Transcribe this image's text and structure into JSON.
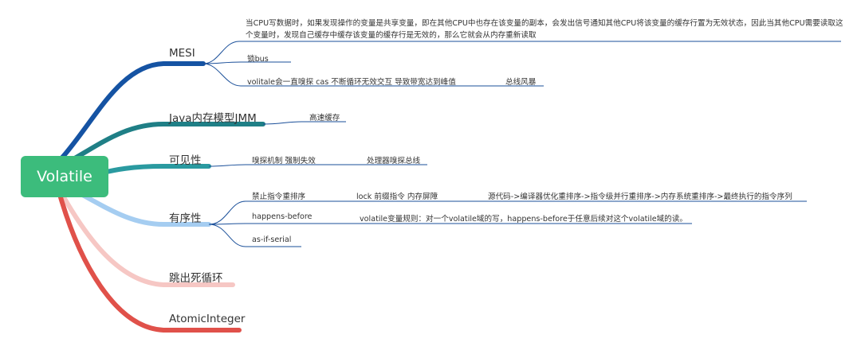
{
  "root": {
    "label": "Volatile"
  },
  "colors": {
    "root": "#3cbc7c",
    "mesi": "#1553a3",
    "jmm": "#1f7f86",
    "visibility": "#2a9aa0",
    "order": "#a5cdf1",
    "loop": "#f6c7c4",
    "atomic": "#e0514a",
    "line": "#1a4f99"
  },
  "branches": {
    "mesi": {
      "label": "MESI",
      "children": [
        "当CPU写数据时，如果发现操作的变量是共享变量，即在其他CPU中也存在该变量的副本，会发出信号通知其他CPU将该变量的缓存行置为无效状态，因此当其他CPU需要读取这个变量时，发现自己缓存中缓存该变量的缓存行是无效的，那么它就会从内存重新读取",
        "锁bus",
        "volitale会一直嗅探 cas 不断循环无效交互 导致带宽达到峰值"
      ],
      "grandchild": "总线风暴"
    },
    "jmm": {
      "label": "Java内存模型JMM",
      "child": "高速缓存"
    },
    "visibility": {
      "label": "可见性",
      "child": "嗅探机制 强制失效",
      "grandchild": "处理器嗅探总线"
    },
    "order": {
      "label": "有序性",
      "children": [
        {
          "label": "禁止指令重排序",
          "child": "lock 前缀指令 内存屏障",
          "grandchild": "源代码->编译器优化重排序->指令级并行重排序->内存系统重排序->最终执行的指令序列"
        },
        {
          "label": "happens-before",
          "child": "volatile变量规则：对一个volatile域的写，happens-before于任意后续对这个volatile域的读。"
        },
        {
          "label": "as-if-serial"
        }
      ]
    },
    "loop": {
      "label": "跳出死循环"
    },
    "atomic": {
      "label": "AtomicInteger"
    }
  }
}
